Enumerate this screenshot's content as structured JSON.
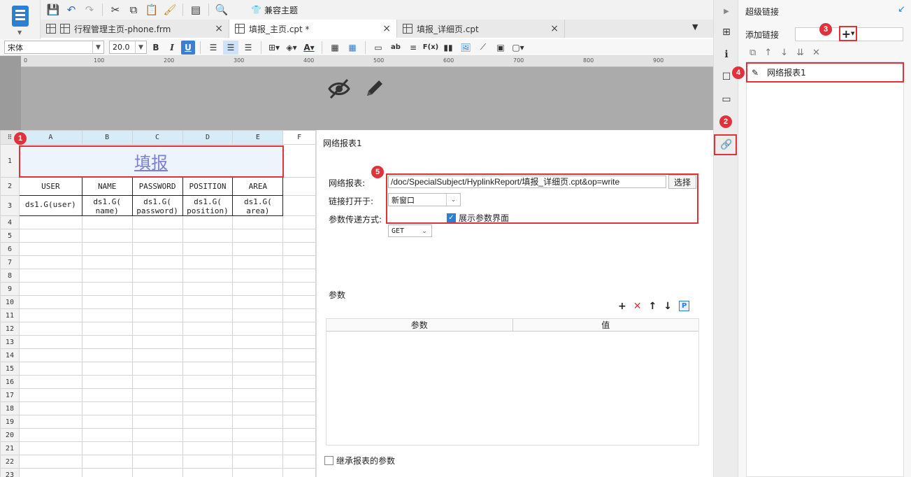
{
  "toolbar": {
    "theme_label": "兼容主题"
  },
  "tabs": [
    {
      "label": "行程管理主页-phone.frm"
    },
    {
      "label": "填报_主页.cpt *"
    },
    {
      "label": "填报_详细页.cpt"
    }
  ],
  "format_bar": {
    "font": "宋体",
    "font_size": "20.0",
    "bold": "B",
    "italic": "I",
    "underline": "U"
  },
  "ruler_ticks": [
    "0",
    "100",
    "200",
    "300",
    "400",
    "500",
    "600",
    "700",
    "800",
    "900"
  ],
  "sheet": {
    "columns": [
      "A",
      "B",
      "C",
      "D",
      "E",
      "F"
    ],
    "rows": [
      "1",
      "2",
      "3",
      "4",
      "5",
      "6",
      "7",
      "8",
      "9",
      "10",
      "11",
      "12",
      "13",
      "14",
      "15",
      "16",
      "17",
      "18",
      "19",
      "20",
      "21",
      "22",
      "23"
    ],
    "title": "填报",
    "headers": [
      "USER",
      "NAME",
      "PASSWORD",
      "POSITION",
      "AREA"
    ],
    "data_row": [
      "ds1.G(user)",
      "ds1.G(\nname)",
      "ds1.G(\npassword)",
      "ds1.G(\nposition)",
      "ds1.G(\narea)"
    ]
  },
  "editor": {
    "title": "网络报表1",
    "report_label": "网络报表:",
    "report_url": "/doc/SpecialSubject/HyplinkReport/填报_详细页.cpt&op=write",
    "choose_label": "选择",
    "open_in_label": "链接打开于:",
    "open_in_value": "新窗口",
    "method_label": "参数传递方式:",
    "method_value": "GET",
    "show_params_label": "展示参数界面",
    "params_title": "参数",
    "params_col_name": "参数",
    "params_col_value": "值",
    "inherit_label": "继承报表的参数"
  },
  "right_panel": {
    "title": "超级链接",
    "add_link_label": "添加链接",
    "items": [
      "网络报表1"
    ]
  },
  "badges": [
    "1",
    "2",
    "3",
    "4",
    "5"
  ],
  "colors": {
    "accent": "#2d7fd3",
    "highlight": "#e0323a"
  }
}
